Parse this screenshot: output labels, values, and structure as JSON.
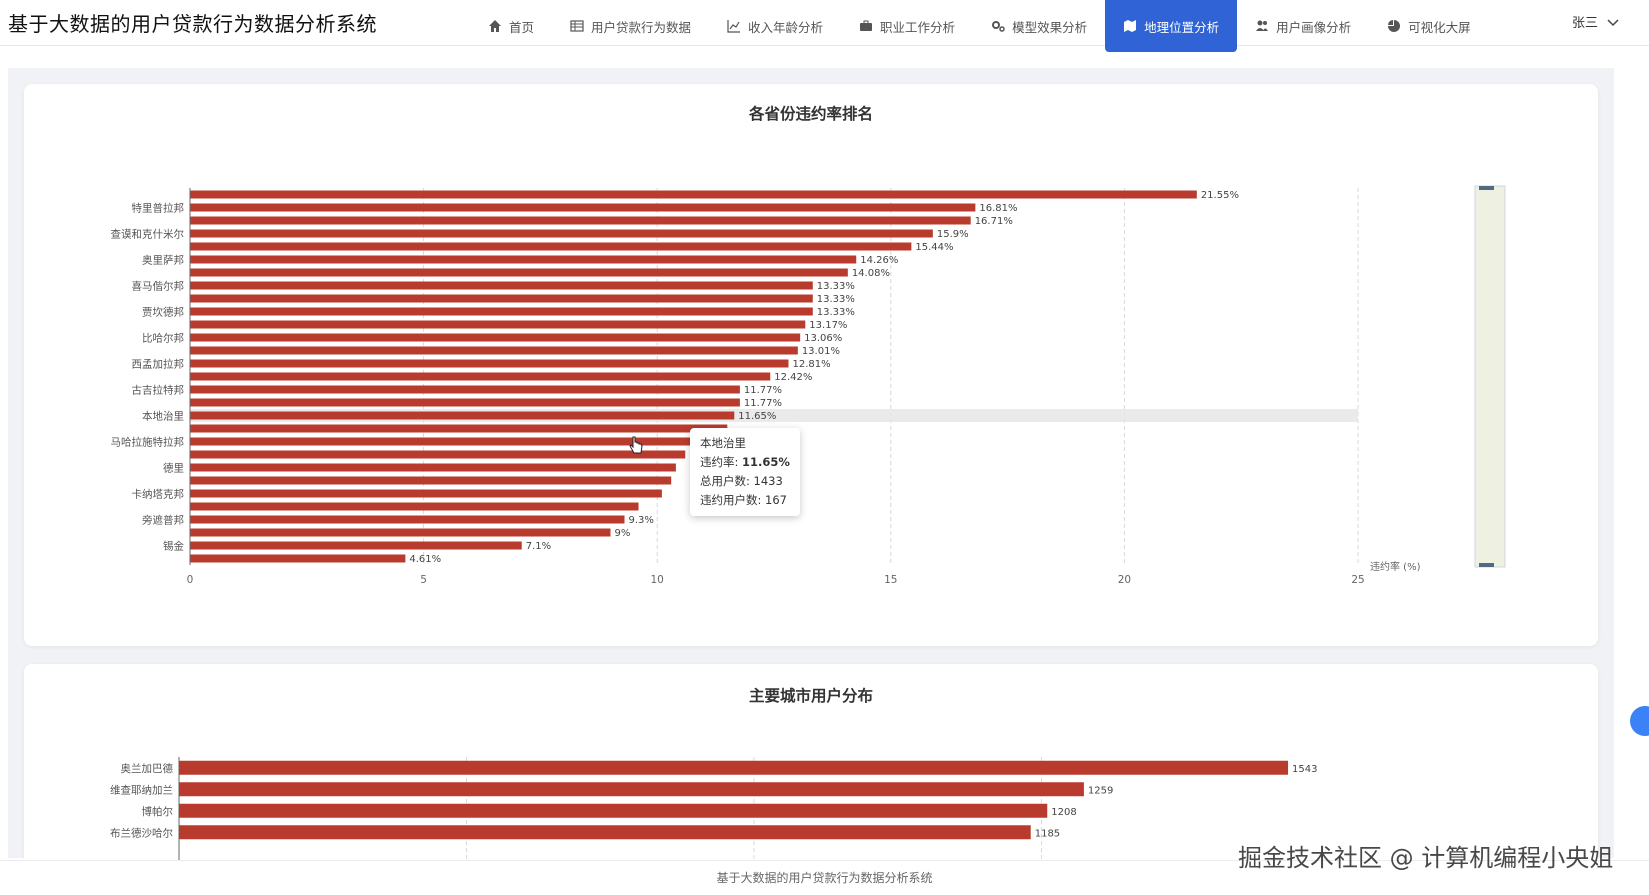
{
  "app": {
    "title": "基于大数据的用户贷款行为数据分析系统"
  },
  "nav": [
    {
      "label": "首页",
      "icon": "home-icon"
    },
    {
      "label": "用户贷款行为数据",
      "icon": "table-icon"
    },
    {
      "label": "收入年龄分析",
      "icon": "line-chart-icon"
    },
    {
      "label": "职业工作分析",
      "icon": "briefcase-icon"
    },
    {
      "label": "模型效果分析",
      "icon": "gears-icon"
    },
    {
      "label": "地理位置分析",
      "icon": "map-icon",
      "active": true
    },
    {
      "label": "用户画像分析",
      "icon": "users-icon"
    },
    {
      "label": "可视化大屏",
      "icon": "pie-chart-icon"
    }
  ],
  "user": {
    "name": "张三"
  },
  "colors": {
    "bar": "#b83b2e",
    "accent": "#2f63d6",
    "tooltip_bg": "#ffffff"
  },
  "chart_data": [
    {
      "type": "bar",
      "orientation": "horizontal",
      "title": "各省份违约率排名",
      "xlabel": "违约率 (%)",
      "xlim": [
        0,
        25
      ],
      "xticks": [
        0,
        5,
        10,
        15,
        20,
        25
      ],
      "grid": true,
      "categories": [
        "",
        "特里普拉邦",
        "",
        "查谟和克什米尔",
        "",
        "奥里萨邦",
        "",
        "喜马偕尔邦",
        "",
        "贾坎德邦",
        "",
        "比哈尔邦",
        "",
        "西孟加拉邦",
        "",
        "古吉拉特邦",
        "",
        "本地治里",
        "",
        "马哈拉施特拉邦",
        "",
        "德里",
        "",
        "卡纳塔克邦",
        "",
        "旁遮普邦",
        "",
        "锡金"
      ],
      "values": [
        21.55,
        16.81,
        16.71,
        15.9,
        15.44,
        14.26,
        14.08,
        13.33,
        13.33,
        13.33,
        13.17,
        13.06,
        13.01,
        12.81,
        12.42,
        11.77,
        11.77,
        11.65,
        11.5,
        10.9,
        10.6,
        10.4,
        10.3,
        10.1,
        9.6,
        9.3,
        9,
        7.1,
        4.61
      ],
      "data_labels": [
        "21.55%",
        "16.81%",
        "16.71%",
        "15.9%",
        "15.44%",
        "14.26%",
        "14.08%",
        "13.33%",
        "13.33%",
        "13.33%",
        "13.17%",
        "13.06%",
        "13.01%",
        "12.81%",
        "12.42%",
        "11.77%",
        "11.77%",
        "11.65%",
        "",
        "",
        "",
        "",
        "",
        "",
        "",
        "9.3%",
        "9%",
        "7.1%",
        "4.61%"
      ],
      "highlight_index": 17
    },
    {
      "type": "bar",
      "orientation": "horizontal",
      "title": "主要城市用户分布",
      "categories": [
        "奥兰加巴德",
        "维查耶纳加兰",
        "博帕尔",
        "布兰德沙哈尔"
      ],
      "values": [
        1543,
        1259,
        1208,
        1185
      ]
    }
  ],
  "tooltip": {
    "name": "本地治里",
    "rate_label": "违约率: ",
    "rate_value": "11.65%",
    "total_label": "总用户数: 1433",
    "default_label": "违约用户数: 167"
  },
  "footer": {
    "text": "基于大数据的用户贷款行为数据分析系统"
  },
  "watermark": {
    "text": "掘金技术社区 @ 计算机编程小央姐"
  }
}
